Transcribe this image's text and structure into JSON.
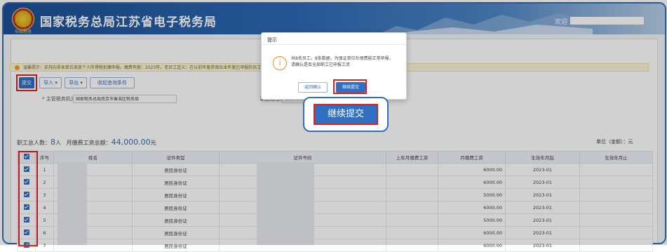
{
  "header": {
    "site_title": "国家税务总局江苏省电子税务局",
    "emblem_text": "中国税务",
    "welcome_label": "欢迎"
  },
  "notice": {
    "text": "温馨提示：支持向非本单位发放个人所得税扣缴申报。缴费年度：2023年。老员工定义：在以前年度参保且本年度已申报的员工，新员工定义：在以前年度未参保本年首次参保的员工"
  },
  "toolbar": {
    "submit_label": "提交",
    "import_label": "导入",
    "export_label": "导出",
    "collapse_label": "收起查询条件"
  },
  "filters": {
    "authority_label": "* 主管税务机关：",
    "authority_value": "国家税务总局南京市秦淮区税务局",
    "employee_label": "职工姓名：",
    "employee_placeholder": "请输入职工姓名"
  },
  "summary": {
    "total_label": "职工总人数：",
    "total_value": "8",
    "total_unit": "人",
    "wage_label": "月缴费工资总额：",
    "wage_value": "44,000.00",
    "wage_unit": "元",
    "unit_note": "单位（金额）：元"
  },
  "table": {
    "headers": [
      "序号",
      "姓名",
      "证件类型",
      "证件号码",
      "上年月缴费工资",
      "月缴费工资",
      "生效年月起",
      "生效年月止"
    ],
    "rows": [
      {
        "no": "1",
        "id_type": "居民身份证",
        "prev": "",
        "wage": "6000.00",
        "start": "2023-01",
        "end": ""
      },
      {
        "no": "2",
        "id_type": "居民身份证",
        "prev": "",
        "wage": "6000.00",
        "start": "2023-01",
        "end": ""
      },
      {
        "no": "3",
        "id_type": "居民身份证",
        "prev": "",
        "wage": "5000.00",
        "start": "2023-01",
        "end": ""
      },
      {
        "no": "4",
        "id_type": "居民身份证",
        "prev": "",
        "wage": "6000.00",
        "start": "2023-01",
        "end": ""
      },
      {
        "no": "5",
        "id_type": "居民身份证",
        "prev": "",
        "wage": "5000.00",
        "start": "2023-01",
        "end": ""
      },
      {
        "no": "6",
        "id_type": "居民身份证",
        "prev": "",
        "wage": "6000.00",
        "start": "2023-01",
        "end": ""
      },
      {
        "no": "7",
        "id_type": "居民身份证",
        "prev": "",
        "wage": "6000.00",
        "start": "2023-01",
        "end": ""
      }
    ]
  },
  "dialog": {
    "title": "提示",
    "icon": "info-icon",
    "message": "共8名员工，8条数据，为保证单位社保费能正常申报，请确认是否全部职工已申报工资",
    "back_label": "返回确认",
    "continue_label": "继续提交"
  },
  "callout": {
    "label": "继续提交"
  },
  "colors": {
    "primary": "#2f6fc1",
    "highlight": "#e02020",
    "header_dark": "#1c4f95"
  }
}
